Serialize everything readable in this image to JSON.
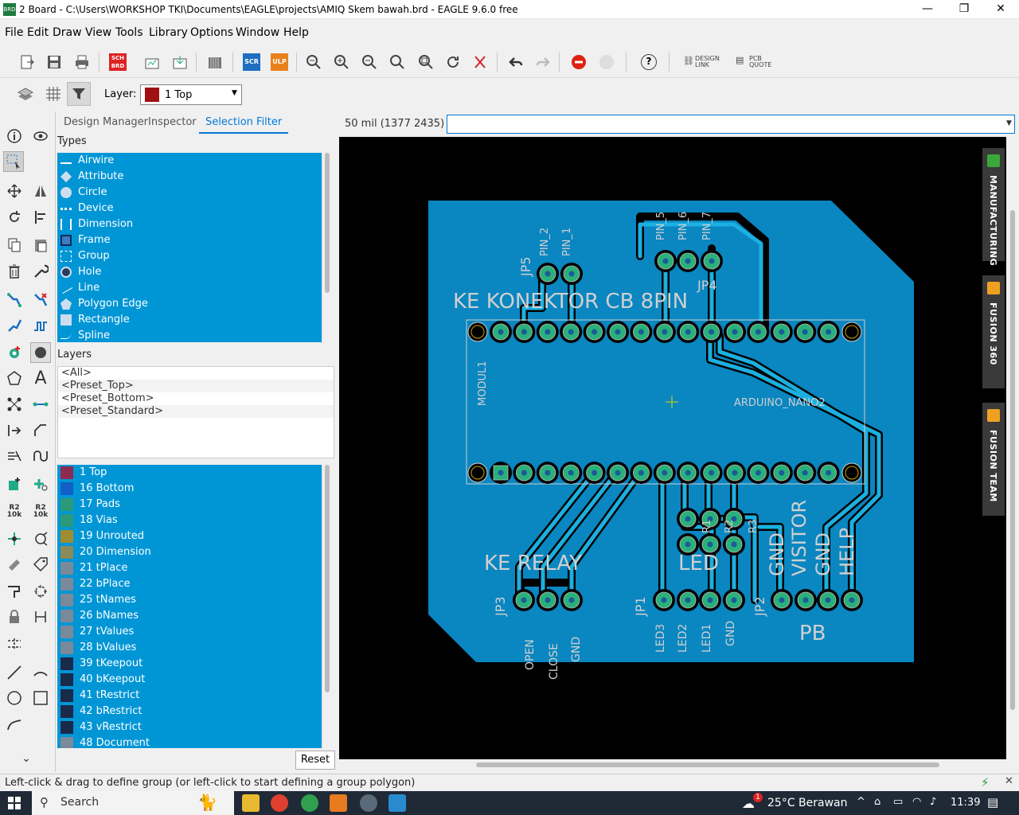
{
  "window": {
    "title": "2 Board - C:\\Users\\WORKSHOP TKI\\Documents\\EAGLE\\projects\\AMIQ Skem bawah.brd - EAGLE 9.6.0 free",
    "app_icon_label": "BRD",
    "minimize": "—",
    "maximize": "❐",
    "close": "✕"
  },
  "menu": [
    "File",
    "Edit",
    "Draw",
    "View",
    "Tools",
    "Library",
    "Options",
    "Window",
    "Help"
  ],
  "toolbar": {
    "sch_brd_label": "SCH BRD",
    "scr_label": "SCR",
    "ulp_label": "ULP",
    "design_link_label": "DESIGN LINK",
    "pcb_quote_label": "PCB QUOTE",
    "help_label": "?"
  },
  "layer_selector": {
    "label": "Layer:",
    "value": "1 Top",
    "color": "#a01010"
  },
  "panel": {
    "tabs": [
      "Design Manager",
      "Inspector",
      "Selection Filter"
    ],
    "active_tab": "Selection Filter",
    "types_header": "Types",
    "types": [
      {
        "label": "Airwire",
        "icon": "airwire-icon"
      },
      {
        "label": "Attribute",
        "icon": "tag-icon"
      },
      {
        "label": "Circle",
        "icon": "circle-icon"
      },
      {
        "label": "Device",
        "icon": "device-icon"
      },
      {
        "label": "Dimension",
        "icon": "dimension-icon"
      },
      {
        "label": "Frame",
        "icon": "frame-icon"
      },
      {
        "label": "Group",
        "icon": "group-icon"
      },
      {
        "label": "Hole",
        "icon": "hole-icon"
      },
      {
        "label": "Line",
        "icon": "line-icon"
      },
      {
        "label": "Polygon Edge",
        "icon": "polygon-icon"
      },
      {
        "label": "Rectangle",
        "icon": "rectangle-icon"
      },
      {
        "label": "Spline",
        "icon": "spline-icon"
      }
    ],
    "layers_header": "Layers",
    "presets": [
      "<All>",
      "<Preset_Top>",
      "<Preset_Bottom>",
      "<Preset_Standard>"
    ],
    "layers": [
      {
        "label": "1 Top",
        "color": "#8c2a52"
      },
      {
        "label": "16 Bottom",
        "color": "#1060c8"
      },
      {
        "label": "17 Pads",
        "color": "#2a9a7a"
      },
      {
        "label": "18 Vias",
        "color": "#2a9a7a"
      },
      {
        "label": "19 Unrouted",
        "color": "#a08c30"
      },
      {
        "label": "20 Dimension",
        "color": "#8a8a5a"
      },
      {
        "label": "21 tPlace",
        "color": "#7a8a9a"
      },
      {
        "label": "22 bPlace",
        "color": "#7a8a9a"
      },
      {
        "label": "25 tNames",
        "color": "#7a8a9a"
      },
      {
        "label": "26 bNames",
        "color": "#7a8a9a"
      },
      {
        "label": "27 tValues",
        "color": "#7a8a9a"
      },
      {
        "label": "28 bValues",
        "color": "#7a8a9a"
      },
      {
        "label": "39 tKeepout",
        "color": "#1a2a4a"
      },
      {
        "label": "40 bKeepout",
        "color": "#1a2a4a"
      },
      {
        "label": "41 tRestrict",
        "color": "#1a2a4a"
      },
      {
        "label": "42 bRestrict",
        "color": "#1a2a4a"
      },
      {
        "label": "43 vRestrict",
        "color": "#1a2a4a"
      },
      {
        "label": "48 Document",
        "color": "#7a8a9a"
      }
    ],
    "reset_label": "Reset"
  },
  "coord_readout": "50 mil (1377 2435)",
  "command_input": "",
  "board": {
    "board_color": "#0a86c0",
    "pad_color": "#2ab07a",
    "text_color": "#c8c8c8",
    "labels": {
      "ke_konektor": "KE KONEKTOR CB 8PIN",
      "ke_relay": "KE RELAY",
      "led": "LED",
      "pb": "PB",
      "modul": "MODUL1",
      "arduino": "ARDUINO_NANO2",
      "jp5": "JP5",
      "jp4": "JP4",
      "jp3": "JP3",
      "jp1": "JP1",
      "jp2": "JP2",
      "pin2": "PIN_2",
      "pin1": "PIN_1",
      "pin5": "PIN_5",
      "pin6": "PIN_6",
      "pin7": "PIN_7",
      "open": "OPEN",
      "close": "CLOSE",
      "gnd_relay": "GND",
      "led3": "LED3",
      "led2": "LED2",
      "led1": "LED1",
      "gnd_led": "GND",
      "gnd_pb1": "GND",
      "visitor": "VISITOR",
      "gnd_pb2": "GND",
      "help": "HELP",
      "r1": "R1",
      "r2": "R2",
      "r3": "R3"
    }
  },
  "right_tabs": [
    {
      "label": "MANUFACTURING",
      "color": "#3aa83a"
    },
    {
      "label": "FUSION 360",
      "color": "#f0a020"
    },
    {
      "label": "FUSION TEAM",
      "color": "#f0a020"
    }
  ],
  "status_message": "Left-click & drag to define group (or left-click to start defining a group polygon)",
  "taskbar": {
    "search_label": "Search",
    "weather": "25°C  Berawan",
    "time": "11:39",
    "weather_badge": "1"
  }
}
